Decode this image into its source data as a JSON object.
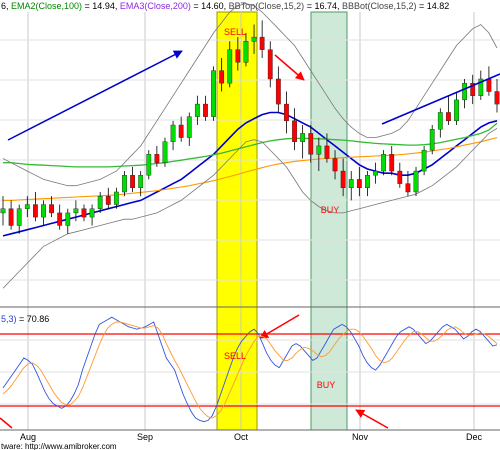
{
  "header": {
    "parts": [
      {
        "text": "6,",
        "color": "#000000"
      },
      {
        "text": "EMA2(Close,100)",
        "color": "#008800"
      },
      {
        "text": "= 14.94,",
        "color": "#000000"
      },
      {
        "text": "EMA3(Close,200)",
        "color": "#8a2be2"
      },
      {
        "text": "= 14.60,",
        "color": "#000000"
      },
      {
        "text": "BBTop(Close,15,2)",
        "color": "#444444"
      },
      {
        "text": "= 16.74,",
        "color": "#000000"
      },
      {
        "text": "BBBot(Close,15,2)",
        "color": "#444444"
      },
      {
        "text": "= 14.82",
        "color": "#000000"
      }
    ]
  },
  "indicator_header": {
    "parts": [
      {
        "text": "5,3)",
        "color": "#1f3fd0"
      },
      {
        "text": "= 70.86",
        "color": "#000000"
      }
    ]
  },
  "annotations": {
    "sell_top": "SELL",
    "buy_top": "BUY",
    "sell_bottom": "SELL",
    "buy_bottom": "BUY"
  },
  "footer": {
    "text": "tware: http://www.amibroker.com"
  },
  "colors": {
    "up_candle": "#00dd00",
    "down_candle": "#ff0000",
    "ema_fast": "#0000cc",
    "ema_100": "#33bb33",
    "ema_200": "#ff9900",
    "bands": "#777777",
    "stoch_k": "#3355dd",
    "stoch_d": "#ff9933",
    "levels": "#ff0000",
    "arrow_blue": "#0000cc",
    "arrow_red": "#ff0000",
    "sell_zone": "#ffff00",
    "buy_zone": "#cfe9d8"
  },
  "chart_data": [
    {
      "type": "candlestick",
      "x_ticks": [
        "Aug",
        "Sep",
        "Oct",
        "Nov",
        "Dec"
      ],
      "ylim": [
        10.6,
        17.6
      ],
      "grid": true,
      "candles": [
        [
          12.8,
          13.2,
          12.5,
          12.9
        ],
        [
          12.9,
          13.1,
          12.4,
          12.5
        ],
        [
          12.5,
          13.0,
          12.3,
          12.9
        ],
        [
          12.9,
          13.2,
          12.7,
          13.0
        ],
        [
          13.0,
          13.3,
          12.6,
          12.7
        ],
        [
          12.7,
          13.1,
          12.5,
          13.0
        ],
        [
          13.0,
          13.2,
          12.7,
          12.8
        ],
        [
          12.8,
          13.0,
          12.4,
          12.5
        ],
        [
          12.5,
          12.9,
          12.3,
          12.8
        ],
        [
          12.8,
          13.1,
          12.6,
          12.9
        ],
        [
          12.9,
          13.0,
          12.6,
          12.7
        ],
        [
          12.7,
          13.0,
          12.5,
          12.9
        ],
        [
          12.9,
          13.3,
          12.8,
          13.2
        ],
        [
          13.2,
          13.4,
          12.9,
          13.0
        ],
        [
          13.0,
          13.4,
          12.9,
          13.3
        ],
        [
          13.3,
          13.8,
          13.2,
          13.7
        ],
        [
          13.7,
          13.9,
          13.3,
          13.4
        ],
        [
          13.4,
          13.8,
          13.2,
          13.7
        ],
        [
          13.7,
          14.3,
          13.6,
          14.2
        ],
        [
          14.2,
          14.4,
          13.9,
          14.0
        ],
        [
          14.0,
          14.6,
          13.9,
          14.5
        ],
        [
          14.5,
          15.0,
          14.3,
          14.9
        ],
        [
          14.9,
          15.1,
          14.5,
          14.6
        ],
        [
          14.6,
          15.2,
          14.4,
          15.1
        ],
        [
          15.1,
          15.6,
          14.9,
          15.4
        ],
        [
          15.4,
          15.6,
          15.0,
          15.1
        ],
        [
          15.1,
          16.3,
          15.0,
          16.2
        ],
        [
          16.2,
          16.5,
          15.7,
          15.9
        ],
        [
          15.9,
          16.9,
          15.8,
          16.7
        ],
        [
          16.7,
          17.0,
          16.2,
          16.4
        ],
        [
          16.4,
          17.1,
          16.3,
          16.9
        ],
        [
          16.9,
          17.3,
          16.6,
          17.0
        ],
        [
          17.0,
          17.4,
          16.5,
          16.7
        ],
        [
          16.7,
          16.9,
          15.8,
          16.0
        ],
        [
          16.0,
          16.3,
          15.2,
          15.4
        ],
        [
          15.4,
          15.7,
          14.7,
          15.0
        ],
        [
          15.0,
          15.3,
          14.3,
          14.5
        ],
        [
          14.5,
          14.9,
          14.1,
          14.7
        ],
        [
          14.7,
          14.9,
          14.0,
          14.2
        ],
        [
          14.2,
          14.6,
          13.8,
          14.4
        ],
        [
          14.4,
          14.7,
          14.0,
          14.1
        ],
        [
          14.1,
          14.3,
          13.6,
          13.8
        ],
        [
          13.8,
          14.1,
          13.2,
          13.4
        ],
        [
          13.4,
          13.8,
          13.1,
          13.6
        ],
        [
          13.6,
          13.9,
          13.2,
          13.4
        ],
        [
          13.4,
          13.8,
          13.2,
          13.7
        ],
        [
          13.7,
          14.0,
          13.5,
          13.8
        ],
        [
          13.8,
          14.3,
          13.7,
          14.2
        ],
        [
          14.2,
          14.4,
          13.7,
          13.8
        ],
        [
          13.8,
          14.0,
          13.4,
          13.5
        ],
        [
          13.5,
          13.8,
          13.2,
          13.3
        ],
        [
          13.3,
          13.9,
          13.2,
          13.8
        ],
        [
          13.8,
          14.4,
          13.7,
          14.3
        ],
        [
          14.3,
          14.9,
          14.2,
          14.8
        ],
        [
          14.8,
          15.3,
          14.6,
          15.2
        ],
        [
          15.2,
          15.6,
          14.9,
          15.0
        ],
        [
          15.0,
          15.7,
          14.9,
          15.5
        ],
        [
          15.5,
          16.0,
          15.3,
          15.9
        ],
        [
          15.9,
          16.1,
          15.4,
          15.6
        ],
        [
          15.6,
          16.2,
          15.5,
          16.0
        ],
        [
          16.0,
          16.3,
          15.6,
          15.7
        ],
        [
          15.7,
          16.0,
          15.2,
          15.4
        ]
      ],
      "series": [
        {
          "values": [
            12.25,
            12.3,
            12.35,
            12.4,
            12.45,
            12.5,
            12.55,
            12.6,
            12.65,
            12.7,
            12.75,
            12.8,
            12.85,
            12.9,
            12.95,
            13.0,
            13.05,
            13.1,
            13.2,
            13.3,
            13.4,
            13.5,
            13.6,
            13.75,
            13.9,
            14.05,
            14.2,
            14.4,
            14.6,
            14.8,
            14.95,
            15.05,
            15.15,
            15.2,
            15.2,
            15.15,
            15.05,
            14.95,
            14.85,
            14.7,
            14.55,
            14.4,
            14.25,
            14.1,
            13.95,
            13.85,
            13.8,
            13.75,
            13.75,
            13.7,
            13.7,
            13.75,
            13.85,
            13.95,
            14.1,
            14.25,
            14.4,
            14.55,
            14.7,
            14.85,
            14.95,
            15.0
          ]
        },
        {
          "values": [
            14.0,
            14.0,
            13.98,
            13.96,
            13.95,
            13.94,
            13.93,
            13.92,
            13.91,
            13.9,
            13.9,
            13.9,
            13.9,
            13.9,
            13.91,
            13.92,
            13.93,
            13.94,
            13.96,
            13.98,
            14.0,
            14.03,
            14.06,
            14.09,
            14.12,
            14.15,
            14.19,
            14.23,
            14.28,
            14.33,
            14.38,
            14.43,
            14.48,
            14.52,
            14.55,
            14.57,
            14.58,
            14.58,
            14.58,
            14.57,
            14.56,
            14.55,
            14.54,
            14.52,
            14.5,
            14.48,
            14.46,
            14.45,
            14.44,
            14.43,
            14.42,
            14.42,
            14.43,
            14.45,
            14.48,
            14.52,
            14.56,
            14.6,
            14.65,
            14.7,
            14.78,
            14.94
          ]
        },
        {
          "values": [
            13.1,
            13.1,
            13.11,
            13.12,
            13.13,
            13.14,
            13.15,
            13.16,
            13.17,
            13.18,
            13.19,
            13.2,
            13.21,
            13.22,
            13.23,
            13.25,
            13.27,
            13.29,
            13.31,
            13.33,
            13.36,
            13.39,
            13.42,
            13.45,
            13.49,
            13.53,
            13.57,
            13.62,
            13.67,
            13.72,
            13.78,
            13.83,
            13.88,
            13.93,
            13.97,
            14.0,
            14.03,
            14.05,
            14.07,
            14.09,
            14.1,
            14.11,
            14.12,
            14.13,
            14.14,
            14.15,
            14.16,
            14.17,
            14.18,
            14.19,
            14.21,
            14.23,
            14.25,
            14.28,
            14.31,
            14.34,
            14.38,
            14.42,
            14.46,
            14.5,
            14.55,
            14.6
          ]
        },
        {
          "values": [
            14.1,
            14.0,
            13.9,
            13.8,
            13.7,
            13.6,
            13.55,
            13.5,
            13.45,
            13.45,
            13.5,
            13.55,
            13.6,
            13.7,
            13.8,
            14.0,
            14.2,
            14.4,
            14.7,
            15.0,
            15.3,
            15.6,
            15.9,
            16.2,
            16.5,
            16.8,
            17.1,
            17.35,
            17.6,
            17.75,
            17.8,
            17.75,
            17.6,
            17.4,
            17.2,
            17.0,
            16.8,
            16.5,
            16.2,
            15.9,
            15.6,
            15.3,
            15.05,
            14.85,
            14.7,
            14.6,
            14.6,
            14.65,
            14.7,
            14.8,
            15.0,
            15.3,
            15.6,
            15.9,
            16.2,
            16.5,
            16.8,
            17.0,
            17.2,
            17.3,
            17.1,
            16.74
          ]
        },
        {
          "values": [
            11.0,
            11.2,
            11.4,
            11.6,
            11.8,
            12.0,
            12.1,
            12.2,
            12.3,
            12.35,
            12.4,
            12.45,
            12.5,
            12.55,
            12.6,
            12.65,
            12.65,
            12.7,
            12.75,
            12.8,
            12.9,
            13.0,
            13.1,
            13.25,
            13.4,
            13.55,
            13.7,
            13.9,
            14.1,
            14.3,
            14.5,
            14.55,
            14.5,
            14.3,
            14.1,
            13.9,
            13.6,
            13.3,
            13.1,
            12.95,
            12.85,
            12.8,
            12.8,
            12.85,
            12.9,
            12.95,
            13.0,
            13.05,
            13.1,
            13.15,
            13.2,
            13.25,
            13.35,
            13.45,
            13.6,
            13.75,
            13.9,
            14.1,
            14.3,
            14.5,
            14.7,
            14.82
          ]
        }
      ]
    },
    {
      "type": "line",
      "ylim": [
        0,
        100
      ],
      "levels": [
        80,
        20
      ],
      "series": [
        {
          "values": [
            35,
            40,
            45,
            50,
            55,
            60,
            58,
            55,
            48,
            40,
            32,
            26,
            22,
            20,
            18,
            20,
            24,
            30,
            38,
            50,
            60,
            70,
            80,
            88,
            90,
            92,
            94,
            92,
            90,
            88,
            86,
            85,
            84,
            85,
            86,
            88,
            90,
            80,
            70,
            60,
            55,
            50,
            40,
            30,
            22,
            15,
            10,
            8,
            7,
            8,
            12,
            20,
            30,
            40,
            50,
            60,
            68,
            74,
            78,
            82,
            84,
            80,
            72,
            64,
            58,
            54,
            52,
            58,
            64,
            70,
            72,
            70,
            66,
            62,
            58,
            60,
            66,
            72,
            78,
            84,
            86,
            88,
            86,
            82,
            76,
            70,
            62,
            56,
            52,
            50,
            54,
            60,
            66,
            72,
            78,
            82,
            84,
            86,
            84,
            80,
            76,
            72,
            74,
            78,
            82,
            86,
            88,
            86,
            84,
            80,
            76,
            78,
            82,
            84,
            82,
            78,
            74,
            70,
            71
          ]
        },
        {
          "values": [
            30,
            33,
            37,
            42,
            47,
            52,
            55,
            56,
            54,
            50,
            44,
            38,
            32,
            27,
            23,
            21,
            21,
            24,
            28,
            35,
            44,
            53,
            62,
            71,
            79,
            85,
            88,
            90,
            90,
            89,
            88,
            87,
            86,
            85,
            85,
            86,
            87,
            85,
            80,
            72,
            65,
            58,
            52,
            45,
            38,
            31,
            24,
            18,
            14,
            11,
            10,
            12,
            16,
            22,
            30,
            38,
            46,
            54,
            62,
            68,
            74,
            78,
            78,
            76,
            71,
            66,
            62,
            58,
            58,
            60,
            64,
            67,
            69,
            68,
            66,
            63,
            61,
            62,
            65,
            70,
            75,
            79,
            82,
            84,
            84,
            82,
            78,
            73,
            68,
            62,
            58,
            56,
            57,
            60,
            65,
            70,
            75,
            79,
            82,
            82,
            80,
            77,
            74,
            74,
            76,
            79,
            83,
            85,
            86,
            84,
            81,
            79,
            79,
            80,
            81,
            80,
            78,
            75,
            72
          ]
        }
      ]
    }
  ]
}
